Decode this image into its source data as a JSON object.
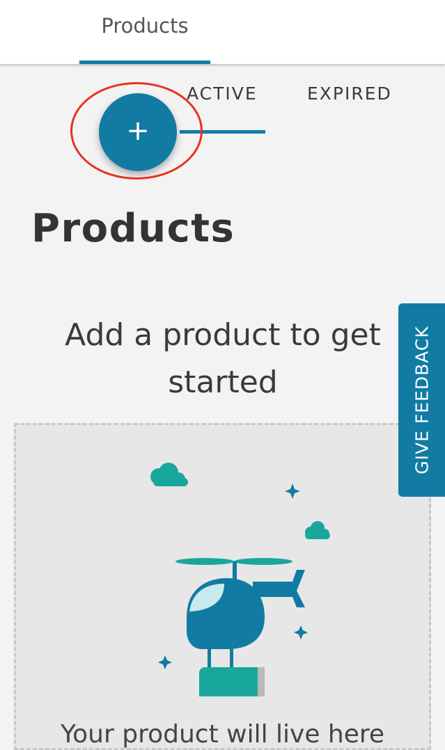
{
  "header": {
    "tab_label": "Products"
  },
  "subtabs": {
    "active_label": "ACTIVE",
    "expired_label": "EXPIRED"
  },
  "fab": {
    "label": "+"
  },
  "main": {
    "title": "Products",
    "empty_heading": "Add a product to get started",
    "empty_caption": "Your product will live here"
  },
  "feedback": {
    "label": "GIVE FEEDBACK"
  },
  "colors": {
    "accent": "#127ba3",
    "highlight": "#e8311f",
    "teal": "#1aa79b",
    "background": "#f3f3f3"
  },
  "icons": {
    "fab": "plus-icon",
    "illustration": "helicopter-illustration"
  }
}
